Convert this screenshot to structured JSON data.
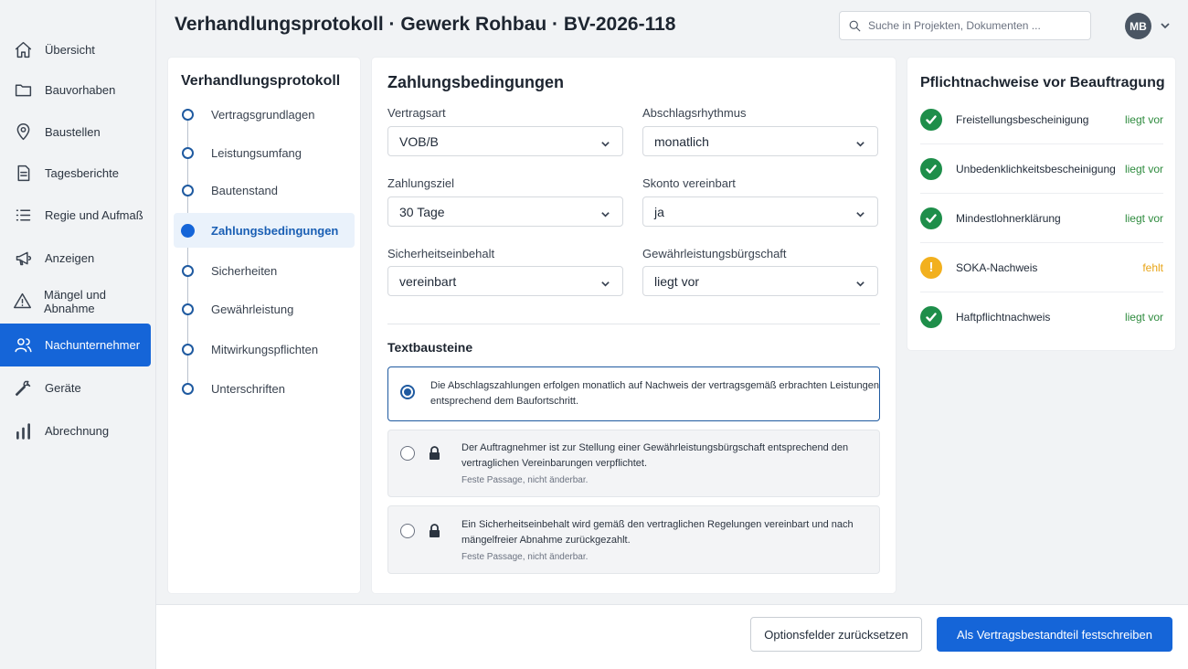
{
  "header": {
    "title": "Verhandlungsprotokoll · Gewerk Rohbau · BV-2026-118",
    "search_placeholder": "Suche in Projekten, Dokumenten ...",
    "avatar_initials": "MB"
  },
  "sidebar": {
    "items": [
      {
        "label": "Übersicht",
        "icon": "home-icon"
      },
      {
        "label": "Bauvorhaben",
        "icon": "folder-icon"
      },
      {
        "label": "Baustellen",
        "icon": "map-pin-icon"
      },
      {
        "label": "Tagesberichte",
        "icon": "document-icon"
      },
      {
        "label": "Regie und Aufmaß",
        "icon": "list-icon"
      },
      {
        "label": "Anzeigen",
        "icon": "megaphone-icon"
      },
      {
        "label": "Mängel und Abnahme",
        "icon": "warning-icon"
      },
      {
        "label": "Nachunternehmer",
        "icon": "users-icon"
      },
      {
        "label": "Geräte",
        "icon": "wrench-icon"
      },
      {
        "label": "Abrechnung",
        "icon": "bar-chart-icon"
      }
    ],
    "active": "Nachunternehmer"
  },
  "steps": {
    "title": "Verhandlungsprotokoll",
    "items": [
      "Vertragsgrundlagen",
      "Leistungsumfang",
      "Bautenstand",
      "Zahlungsbedingungen",
      "Sicherheiten",
      "Gewährleistung",
      "Mitwirkungspflichten",
      "Unterschriften"
    ],
    "active": "Zahlungsbedingungen"
  },
  "form": {
    "title": "Zahlungsbedingungen",
    "fields": [
      {
        "label": "Vertragsart",
        "value": "VOB/B"
      },
      {
        "label": "Abschlagsrhythmus",
        "value": "monatlich"
      },
      {
        "label": "Zahlungsziel",
        "value": "30 Tage"
      },
      {
        "label": "Skonto vereinbart",
        "value": "ja"
      },
      {
        "label": "Sicherheitseinbehalt",
        "value": "vereinbart"
      },
      {
        "label": "Gewährleistungsbürgschaft",
        "value": "liegt vor"
      }
    ],
    "textblocks_title": "Textbausteine",
    "textblocks": [
      {
        "line1": "Die Abschlagszahlungen erfolgen monatlich auf Nachweis der vertragsgemäß erbrachten Leistungen",
        "line2": "entsprechend dem Baufortschritt.",
        "note": "",
        "selected": true,
        "locked": false
      },
      {
        "line1": "Der Auftragnehmer ist zur Stellung einer Gewährleistungsbürgschaft entsprechend den",
        "line2": "vertraglichen Vereinbarungen verpflichtet.",
        "note": "Feste Passage, nicht änderbar.",
        "selected": false,
        "locked": true
      },
      {
        "line1": "Ein Sicherheitseinbehalt wird gemäß den vertraglichen Regelungen vereinbart und nach",
        "line2": "mängelfreier Abnahme zurückgezahlt.",
        "note": "Feste Passage, nicht änderbar.",
        "selected": false,
        "locked": true
      }
    ]
  },
  "requirements": {
    "title": "Pflichtnachweise vor Beauftragung",
    "items": [
      {
        "name": "Freistellungsbescheinigung",
        "status": "liegt vor",
        "state": "ok"
      },
      {
        "name": "Unbedenklichkeitsbescheinigung",
        "status": "liegt vor",
        "state": "ok"
      },
      {
        "name": "Mindestlohnerklärung",
        "status": "liegt vor",
        "state": "ok"
      },
      {
        "name": "SOKA-Nachweis",
        "status": "fehlt",
        "state": "warn"
      },
      {
        "name": "Haftpflichtnachweis",
        "status": "liegt vor",
        "state": "ok"
      }
    ]
  },
  "footer": {
    "reset_label": "Optionsfelder zurücksetzen",
    "commit_label": "Als Vertragsbestandteil festschreiben"
  },
  "colors": {
    "primary": "#1565d8",
    "success": "#1e8e4a",
    "warning": "#f2b01e"
  }
}
